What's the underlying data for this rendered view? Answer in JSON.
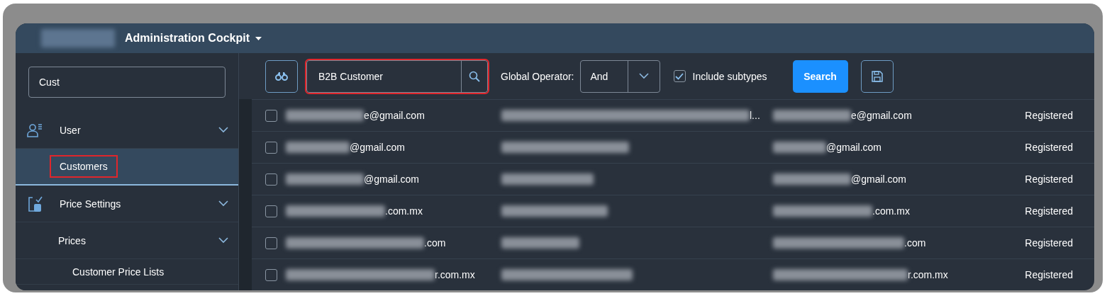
{
  "header": {
    "title": "Administration Cockpit"
  },
  "sidebar": {
    "search": {
      "value": "Cust"
    },
    "items": [
      {
        "kind": "user",
        "label": "User",
        "expanded": true,
        "children": [
          {
            "label": "Customers",
            "selected": true,
            "highlighted": true
          }
        ]
      },
      {
        "kind": "price",
        "label": "Price Settings",
        "expanded": true,
        "children": [
          {
            "label": "Prices",
            "expanded": true,
            "children": [
              {
                "label": "Customer Price Lists",
                "selected": false,
                "highlighted": false
              }
            ]
          }
        ]
      }
    ]
  },
  "toolbar": {
    "search": {
      "value": "B2B Customer",
      "highlighted": true
    },
    "operator_label": "Global Operator:",
    "operator": "And",
    "include_subtypes": {
      "label": "Include subtypes",
      "checked": true
    },
    "search_button": "Search"
  },
  "rows": [
    {
      "checked": false,
      "column_1": "e@gmail.com",
      "column_2": "l...",
      "column_3": "e@gmail.com",
      "column_4": "Registered"
    },
    {
      "checked": false,
      "column_1": "@gmail.com",
      "column_2": "",
      "column_3": "@gmail.com",
      "column_4": "Registered"
    },
    {
      "checked": false,
      "column_1": "@gmail.com",
      "column_2": "",
      "column_3": "@gmail.com",
      "column_4": "Registered"
    },
    {
      "checked": false,
      "column_1": ".com.mx",
      "column_2": "",
      "column_3": ".com.mx",
      "column_4": "Registered"
    },
    {
      "checked": false,
      "column_1": ".com",
      "column_2": "",
      "column_3": ".com",
      "column_4": "Registered"
    },
    {
      "checked": false,
      "column_1": "r.com.mx",
      "column_2": "",
      "column_3": "r.com.mx",
      "column_4": "Registered"
    }
  ]
}
